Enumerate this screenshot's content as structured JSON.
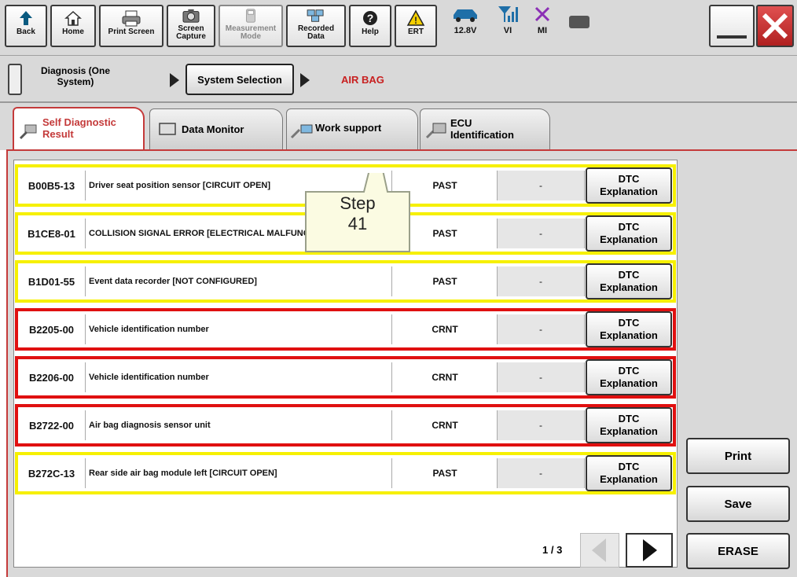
{
  "toolbar": {
    "back": "Back",
    "home": "Home",
    "print_screen": "Print Screen",
    "screen_capture_1": "Screen",
    "screen_capture_2": "Capture",
    "measurement_1": "Measurement",
    "measurement_2": "Mode",
    "recorded_1": "Recorded",
    "recorded_2": "Data",
    "help": "Help",
    "ert": "ERT",
    "voltage": "12.8V",
    "vi": "VI",
    "mi": "MI"
  },
  "breadcrumb": {
    "diagnosis_1": "Diagnosis (One",
    "diagnosis_2": "System)",
    "system_selection": "System Selection",
    "current": "AIR BAG"
  },
  "tabs": {
    "self_diag_1": "Self Diagnostic",
    "self_diag_2": "Result",
    "data_monitor": "Data Monitor",
    "work_support": "Work support",
    "ecu_1": "ECU",
    "ecu_2": "Identification"
  },
  "dtc_rows": [
    {
      "code": "B00B5-13",
      "desc": "Driver seat position sensor [CIRCUIT OPEN]",
      "status": "PAST",
      "value": "-",
      "btn1": "DTC",
      "btn2": "Explanation"
    },
    {
      "code": "B1CE8-01",
      "desc": "COLLISION SIGNAL ERROR [ELECTRICAL MALFUNCTION]",
      "status": "PAST",
      "value": "-",
      "btn1": "DTC",
      "btn2": "Explanation"
    },
    {
      "code": "B1D01-55",
      "desc": "Event data recorder [NOT CONFIGURED]",
      "status": "PAST",
      "value": "-",
      "btn1": "DTC",
      "btn2": "Explanation"
    },
    {
      "code": "B2205-00",
      "desc": "Vehicle identification number",
      "status": "CRNT",
      "value": "-",
      "btn1": "DTC",
      "btn2": "Explanation"
    },
    {
      "code": "B2206-00",
      "desc": "Vehicle identification number",
      "status": "CRNT",
      "value": "-",
      "btn1": "DTC",
      "btn2": "Explanation"
    },
    {
      "code": "B2722-00",
      "desc": "Air bag diagnosis sensor unit",
      "status": "CRNT",
      "value": "-",
      "btn1": "DTC",
      "btn2": "Explanation"
    },
    {
      "code": "B272C-13",
      "desc": "Rear side air bag module left [CIRCUIT OPEN]",
      "status": "PAST",
      "value": "-",
      "btn1": "DTC",
      "btn2": "Explanation"
    }
  ],
  "page_indicator": "1 / 3",
  "side_buttons": {
    "print": "Print",
    "save": "Save",
    "erase": "ERASE"
  },
  "callout": {
    "line1": "Step",
    "line2": "41"
  },
  "colors": {
    "past_border": "#f6f000",
    "crnt_border": "#e01010",
    "active_tab_border": "#c43a3a"
  }
}
